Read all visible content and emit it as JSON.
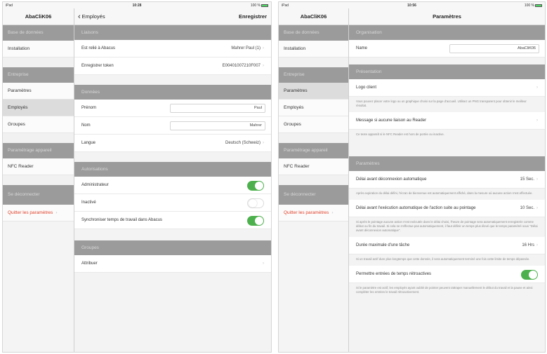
{
  "left": {
    "status": {
      "carrier": "iPad",
      "time": "10:28",
      "battery": "100 %"
    },
    "sidebar": {
      "title": "AbaCliK06",
      "sections": [
        {
          "header": "Base de données",
          "items": [
            {
              "label": "Installation"
            }
          ]
        },
        {
          "header": "Entreprise",
          "items": [
            {
              "label": "Paramètres"
            },
            {
              "label": "Employés"
            },
            {
              "label": "Groupes"
            }
          ]
        },
        {
          "header": "Paramétrage appareil",
          "items": [
            {
              "label": "NFC Reader"
            }
          ]
        },
        {
          "header": "Se déconnecter",
          "items": [
            {
              "label": "Quitter les paramètres"
            }
          ]
        }
      ]
    },
    "nav": {
      "back": "Employés",
      "action": "Enregistrer"
    },
    "liaisons": {
      "header": "Liaisons",
      "rows": [
        {
          "label": "Est relié à Abacus",
          "value": "Mahrer Paul (1)"
        },
        {
          "label": "Enregistrer token",
          "value": "E00401007210F007"
        }
      ]
    },
    "donnees": {
      "header": "Données",
      "prenom": {
        "label": "Prénom",
        "value": "Paul"
      },
      "nom": {
        "label": "Nom",
        "value": "Mahrer"
      },
      "langue": {
        "label": "Langue",
        "value": "Deutsch (Schweiz)"
      }
    },
    "autorisations": {
      "header": "Autorisations",
      "rows": [
        {
          "label": "Administrateur",
          "on": true
        },
        {
          "label": "Inactivé",
          "on": false
        },
        {
          "label": "Synchroniser temps de travail dans Abacus",
          "on": true
        }
      ]
    },
    "groupes": {
      "header": "Groupes",
      "row": "Attribuer"
    }
  },
  "right": {
    "status": {
      "carrier": "iPad",
      "time": "10:56",
      "battery": "100 %"
    },
    "sidebar": {
      "title": "AbaCliK06",
      "sections": [
        {
          "header": "Base de données",
          "items": [
            {
              "label": "Installation"
            }
          ]
        },
        {
          "header": "Entreprise",
          "items": [
            {
              "label": "Paramètres"
            },
            {
              "label": "Employés"
            },
            {
              "label": "Groupes"
            }
          ]
        },
        {
          "header": "Paramétrage appareil",
          "items": [
            {
              "label": "NFC Reader"
            }
          ]
        },
        {
          "header": "Se déconnecter",
          "items": [
            {
              "label": "Quitter les paramètres"
            }
          ]
        }
      ]
    },
    "nav": {
      "title": "Paramètres"
    },
    "organisation": {
      "header": "Organisation",
      "name_label": "Name",
      "name_value": "AbaCliK06"
    },
    "presentation": {
      "header": "Présentation",
      "logo": "Logo client",
      "logo_note": "Vous pouvez placer votre logo ou un graphique choisi sur la page d'accueil. Utilisez un PNG transparent pour obtenir le meilleur résultat.",
      "message": "Message si aucune liaison au Reader",
      "message_note": "Ce texte apparaît si le NFC Reader est hors de portée ou inactive."
    },
    "parametres": {
      "header": "Paramètres",
      "rows": [
        {
          "label": "Délai avant déconnexion automatique",
          "value": "15 Sec.",
          "note": "Après expiration du délai défini, l'écran de bienvenue est automatiquement affiché, dans la mesure où aucune action n'est effectuée."
        },
        {
          "label": "Délai avant l'exécution automatique de l'action suite au pointage",
          "value": "10 Sec.",
          "note": "Si après le pointage aucune action n'est exécutée dans le délai choisi, l'heure de pointage sera automatiquement enregistrée comme début ou fin du travail. Si cela ne s'effectue pas automatiquement, il faut définir un temps plus élevé que le temps paramétré sous \"Délai avant déconnexion automatique\"."
        },
        {
          "label": "Durée maximale d'une tâche",
          "value": "16 Hrs",
          "note": "Si un travail actif dure plus longtemps que cette donnée, il sera automatiquement terminé une fois cette limite de temps dépassée."
        }
      ],
      "toggle": {
        "label": "Permettre entrées de temps rétroactives",
        "on": true,
        "note": "Si le paramètre est actif, les employés ayant oublié de pointer peuvent rattraper manuellement le début du travail et la pause et ainsi compléter les entrées le travail rétroactivement."
      }
    }
  }
}
